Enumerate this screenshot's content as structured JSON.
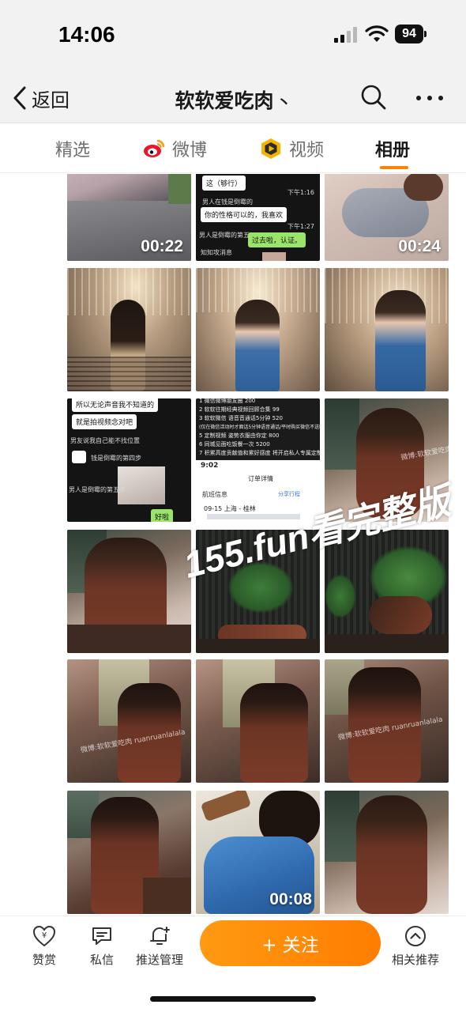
{
  "status_bar": {
    "time": "14:06",
    "battery": "94",
    "icons": [
      "signal-icon",
      "wifi-icon",
      "battery-icon"
    ]
  },
  "header": {
    "back_label": "返回",
    "title": "软软爱吃肉",
    "title_arrow": "丶",
    "icons": [
      "back-chevron-icon",
      "search-icon",
      "more-icon"
    ]
  },
  "tabs": [
    {
      "label": "精选",
      "icon": null,
      "active": false
    },
    {
      "label": "微博",
      "icon": "weibo-icon",
      "active": false
    },
    {
      "label": "视频",
      "icon": "video-play-icon",
      "active": false
    },
    {
      "label": "相册",
      "icon": null,
      "active": true
    }
  ],
  "accent_color": "#ff8200",
  "grid": {
    "watermark": "155.fun看完整版",
    "videos": [
      {
        "duration": "00:22"
      },
      {
        "duration": "00:24"
      },
      {
        "duration": "00:08"
      }
    ],
    "chat_1": {
      "lines": [
        "这（够行）",
        "下午1:16",
        "你的性格可以的，我喜欢",
        "下午1:27",
        "过去啦，认证。",
        "男人在钱是倒霉的",
        "男人是倒霉的第五",
        "知知攻消息"
      ]
    },
    "chat_2": {
      "lines": [
        "所以无论声音我不知道的",
        "就是拍视频念对吧",
        "男友说我自己能不找位置",
        "钱是倒霉的第四步",
        "男人是倒霉的第五步",
        "好啦"
      ]
    },
    "menu_card": {
      "lines": [
        "1 微信微博朋友圈 200",
        "2 软软往期经典视频回顾合集 99",
        "3 软软微信 语音音通话5分钟 520",
        "(仅在微信活动时才面话5分钟语音通话/平时购买微信不送哦)",
        "5 定制视频 姿势衣服由你定 800",
        "6 同城见面吃饭餐一次 5200",
        "7 积累高度贡献值和累好感度 将开启私人专属定制"
      ],
      "time": "9:02",
      "header": "订单详情",
      "section": "航班信息",
      "route": "09-15 上海 - 桂林",
      "share": "分享行程"
    },
    "small_watermarks": [
      "微博:软软爱吃肉",
      "微博:软软爱吃肉 ruanruanlalala",
      "微博:软软爱吃肉 ruanruanlalala"
    ]
  },
  "bottom_bar": {
    "reward_label": "赞赏",
    "message_label": "私信",
    "push_label": "推送管理",
    "follow_label": "+ 关注",
    "related_label": "相关推荐",
    "follow_color": "#ff8200"
  }
}
